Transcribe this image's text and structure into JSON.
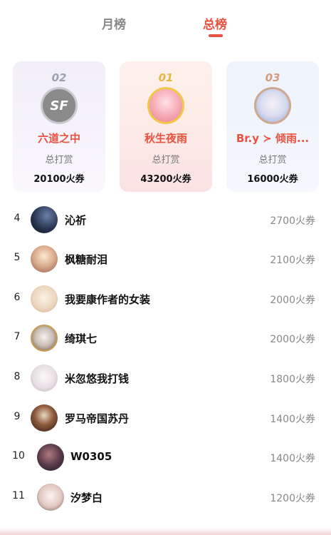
{
  "tabs": {
    "month": "月榜",
    "total": "总榜"
  },
  "podium": [
    {
      "rank": "02",
      "avatar_text": "SF",
      "name": "六道之中",
      "sub": "总打赏",
      "amount": "20100火券"
    },
    {
      "rank": "01",
      "name": "秋生夜雨",
      "sub": "总打赏",
      "amount": "43200火券"
    },
    {
      "rank": "03",
      "name": "Br.y ≻ 倾雨...",
      "sub": "总打赏",
      "amount": "16000火券"
    }
  ],
  "rows": [
    {
      "rank": "4",
      "name": "沁祈",
      "amount": "2700火券"
    },
    {
      "rank": "5",
      "name": "枫糖耐泪",
      "amount": "2100火券"
    },
    {
      "rank": "6",
      "name": "我要康作者的女装",
      "amount": "2000火券"
    },
    {
      "rank": "7",
      "name": "绮琪七",
      "amount": "2000火券"
    },
    {
      "rank": "8",
      "name": "米忽悠我打钱",
      "amount": "1800火券"
    },
    {
      "rank": "9",
      "name": "罗马帝国苏丹",
      "amount": "1400火券"
    },
    {
      "rank": "10",
      "name": "W0305",
      "amount": "1400火券"
    },
    {
      "rank": "11",
      "name": "汐梦白",
      "amount": "1200火券"
    }
  ],
  "colors": {
    "accent": "#e8513f",
    "gold": "#e5b640",
    "silver": "#9aa1b2",
    "bronze": "#d49a7e"
  }
}
